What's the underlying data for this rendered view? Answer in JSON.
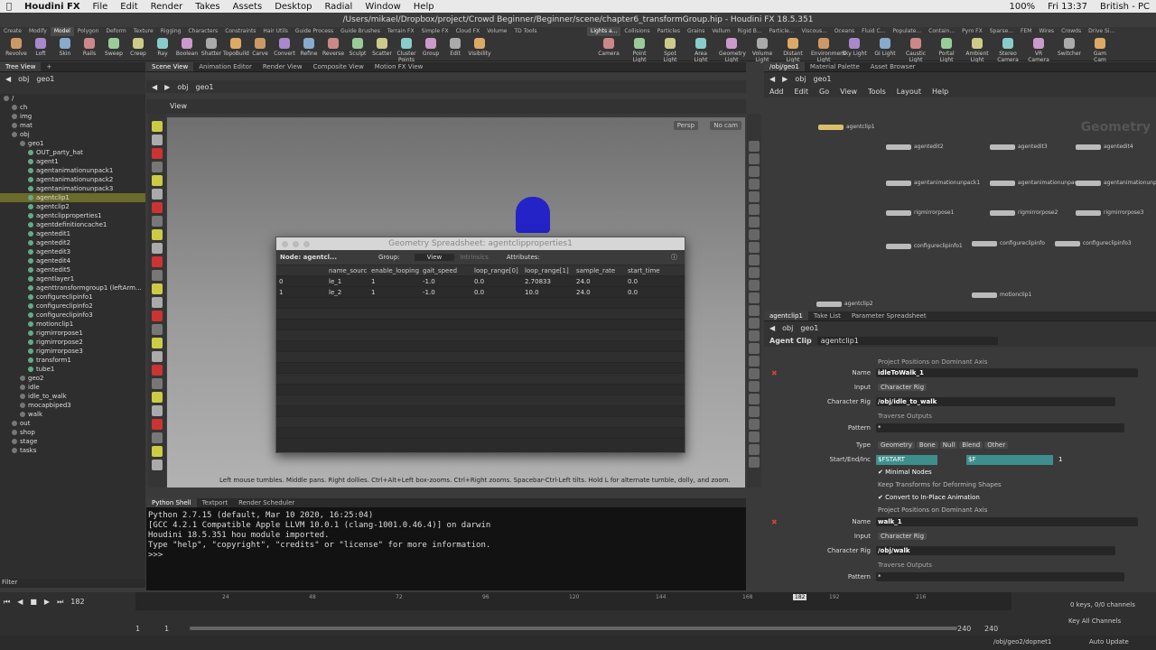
{
  "menubar": {
    "app": "Houdini FX",
    "items": [
      "File",
      "Edit",
      "Render",
      "Takes",
      "Assets",
      "Desktop",
      "Radial",
      "Window",
      "Help"
    ],
    "status": [
      "100%",
      "Fri 13:37",
      "British - PC"
    ]
  },
  "window_title": "/Users/mikael/Dropbox/project/Crowd Beginner/Beginner/scene/chapter6_transformGroup.hip - Houdini FX 18.5.351",
  "shelf": {
    "tabs_left": [
      "Create",
      "Modify",
      "Model",
      "Polygon",
      "Deform",
      "Texture",
      "Rigging",
      "Characters",
      "Constraints",
      "Hair Utils",
      "Guide Process",
      "Guide Brushes",
      "Terrain FX",
      "Simple FX",
      "Cloud FX",
      "Volume",
      "TD Tools"
    ],
    "tools_left": [
      "Revolve",
      "Loft",
      "Skin",
      "Rails",
      "Sweep",
      "Creep",
      "Ray",
      "Boolean",
      "Shatter",
      "TopoBuild",
      "Carve",
      "Convert",
      "Refine",
      "Reverse",
      "Sculpt",
      "Scatter",
      "Cluster Points",
      "Group",
      "Edit",
      "Visibility"
    ],
    "tabs_right": [
      "Lights a...",
      "Collisions",
      "Particles",
      "Grains",
      "Vellum",
      "Rigid B...",
      "Particle...",
      "Viscous...",
      "Oceans",
      "Fluid C...",
      "Populate...",
      "Contain...",
      "Pyro FX",
      "Sparse...",
      "FEM",
      "Wires",
      "Crowds",
      "Drive Si..."
    ],
    "tools_right": [
      "Camera",
      "Point Light",
      "Spot Light",
      "Area Light",
      "Geometry Light",
      "Volume Light",
      "Distant Light",
      "Environment Light",
      "Sky Light",
      "GI Light",
      "Caustic Light",
      "Portal Light",
      "Ambient Light",
      "Stereo Camera",
      "VR Camera",
      "Switcher",
      "Gam Cam"
    ]
  },
  "tree": {
    "tab": "Tree View",
    "path": "obj",
    "node": "geo1",
    "items": [
      "/",
      "ch",
      "img",
      "mat",
      "obj",
      "geo1",
      "OUT_party_hat",
      "agent1",
      "agentanimationunpack1",
      "agentanimationunpack2",
      "agentanimationunpack3",
      "agentclip1",
      "agentclip2",
      "agentclipproperties1",
      "agentdefinitioncache1",
      "agentedit1",
      "agentedit2",
      "agentedit3",
      "agentedit4",
      "agentedit5",
      "agentlayer1",
      "agenttransformgroup1 (leftArm...",
      "configureclipinfo1",
      "configureclipinfo2",
      "configureclipinfo3",
      "motionclip1",
      "rigmirrorpose1",
      "rigmirrorpose2",
      "rigmirrorpose3",
      "transform1",
      "tube1",
      "geo2",
      "idle",
      "idle_to_walk",
      "mocapbiped3",
      "walk",
      "out",
      "shop",
      "stage",
      "tasks"
    ],
    "filter": "Filter"
  },
  "scene_tabs": [
    "Scene View",
    "Animation Editor",
    "Render View",
    "Composite View",
    "Motion FX View"
  ],
  "scene_path": {
    "obj": "obj",
    "node": "geo1"
  },
  "viewport": {
    "label": "View",
    "persp": "Persp",
    "cam": "No cam",
    "hint": "Left mouse tumbles. Middle pans. Right dollies. Ctrl+Alt+Left box-zooms. Ctrl+Right zooms. Spacebar-Ctrl-Left tilts. Hold L for alternate tumble, dolly, and zoom."
  },
  "spreadsheet": {
    "title": "Geometry Spreadsheet: agentclipproperties1",
    "node": "Node: agentcl...",
    "group": "Group:",
    "view": "View",
    "intrinsics": "Intrinsics",
    "attributes": "Attributes:",
    "columns": [
      "",
      "name_sourc",
      "enable_looping",
      "gait_speed",
      "loop_range[0]",
      "loop_range[1]",
      "sample_rate",
      "start_time"
    ],
    "rows": [
      [
        "0",
        "le_1",
        "1",
        "-1.0",
        "0.0",
        "2.70833",
        "24.0",
        "0.0"
      ],
      [
        "1",
        "le_2",
        "1",
        "-1.0",
        "0.0",
        "10.0",
        "24.0",
        "0.0"
      ]
    ]
  },
  "python": {
    "tabs": [
      "Python Shell",
      "Textport",
      "Render Scheduler"
    ],
    "lines": [
      "Python 2.7.15 (default, Mar 10 2020, 16:25:04)",
      "[GCC 4.2.1 Compatible Apple LLVM 10.0.1 (clang-1001.0.46.4)] on darwin",
      "Houdini 18.5.351 hou module imported.",
      "Type \"help\", \"copyright\", \"credits\" or \"license\" for more information.",
      ">>>"
    ]
  },
  "network": {
    "tabs": [
      "/obj/geo1",
      "Material Palette",
      "Asset Browser"
    ],
    "path": {
      "obj": "obj",
      "node": "geo1"
    },
    "menu": [
      "Add",
      "Edit",
      "Go",
      "View",
      "Tools",
      "Layout",
      "Help"
    ],
    "context": "Geometry",
    "nodes": [
      "agentclip1",
      "agentedit2",
      "agentedit3",
      "agentedit4",
      "agentanimationunpack1",
      "agentanimationunpac",
      "agentanimationunpac",
      "rigmirrorpose1",
      "rigmirrorpose2",
      "rigmirrorpose3",
      "configureclipinfo1",
      "configureclipinfo",
      "configureclipinfo3",
      "motionclip1",
      "agentclip2"
    ]
  },
  "params": {
    "tabs": [
      "agentclip1",
      "Take List",
      "Parameter Spreadsheet"
    ],
    "path": {
      "obj": "obj",
      "node": "geo1"
    },
    "type": "Agent Clip",
    "name": "agentclip1",
    "top_text": "Project Positions on Dominant Axis",
    "clip1": {
      "name_label": "Name",
      "name": "idleToWalk_1",
      "input_label": "Input",
      "input": "Character Rig",
      "rig_label": "Character Rig",
      "rig": "/obj/idle_to_walk",
      "traverse": "Traverse Outputs",
      "pattern_label": "Pattern",
      "pattern": "*",
      "type_label": "Type",
      "types": [
        "Geometry",
        "Bone",
        "Null",
        "Blend",
        "Other"
      ],
      "sei_label": "Start/End/Inc",
      "start": "$FSTART",
      "end": "$F",
      "inc": "1",
      "minimal": "Minimal Nodes",
      "keep": "Keep Transforms for Deforming Shapes",
      "convert": "Convert to In-Place Animation",
      "project": "Project Positions on Dominant Axis"
    },
    "clip2": {
      "name_label": "Name",
      "name": "walk_1",
      "input_label": "Input",
      "input": "Character Rig",
      "rig_label": "Character Rig",
      "rig": "/obj/walk",
      "traverse": "Traverse Outputs",
      "pattern_label": "Pattern",
      "pattern": "*"
    }
  },
  "timeline": {
    "frame": "182",
    "ticks": [
      "24",
      "48",
      "72",
      "96",
      "120",
      "144",
      "168",
      "192",
      "216"
    ],
    "start": "1",
    "start2": "1",
    "end": "240",
    "end2": "240",
    "current_marker": "182",
    "keys": "0 keys, 0/0 channels",
    "keyall": "Key All Channels"
  },
  "status": {
    "path": "/obj/geo2/dopnet1",
    "update": "Auto Update"
  }
}
